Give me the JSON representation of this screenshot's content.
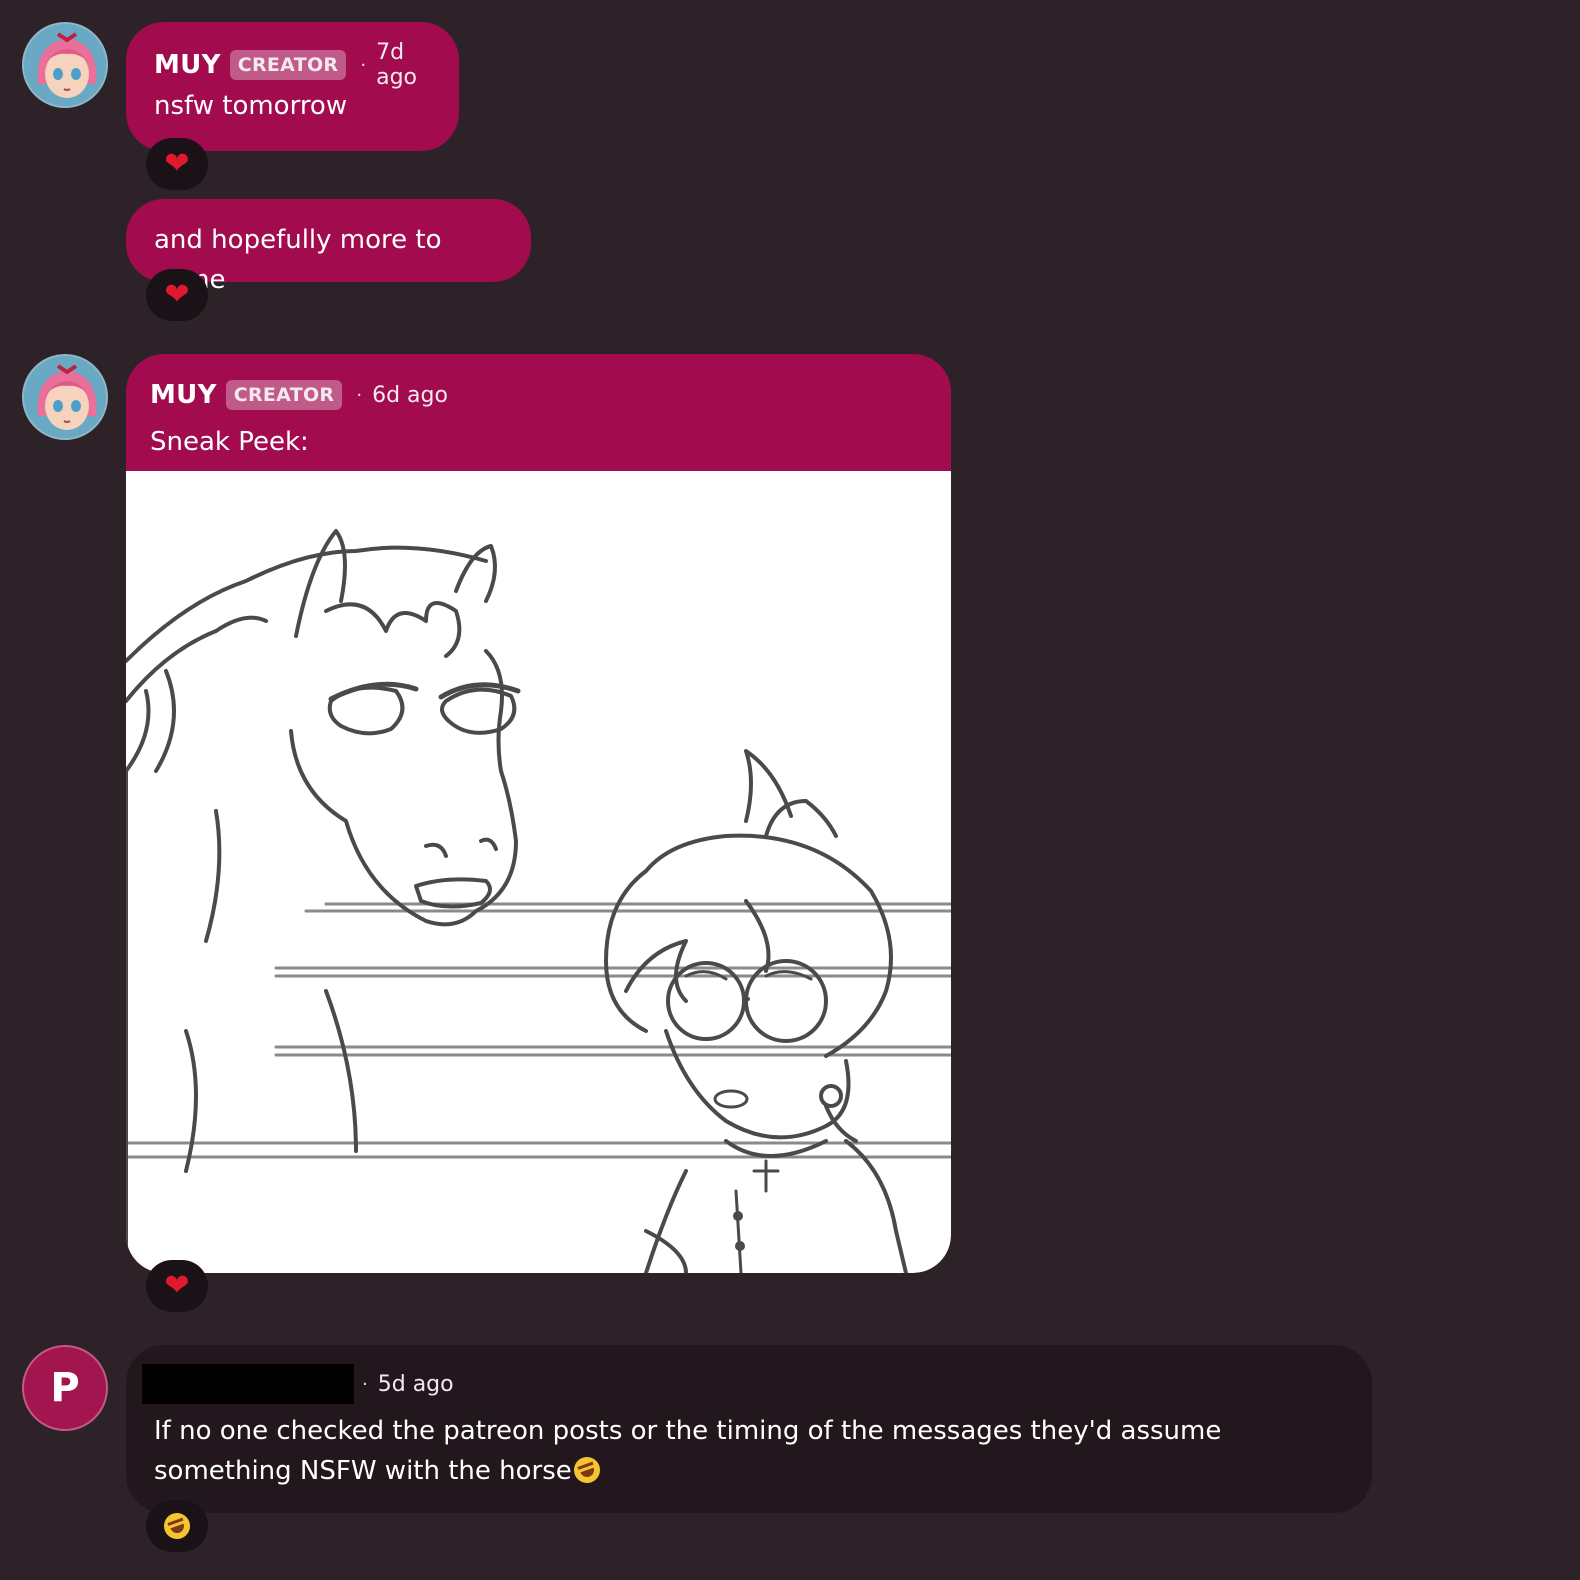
{
  "messages": [
    {
      "author": "MUY",
      "badge": "CREATOR",
      "dot": "·",
      "time": "7d ago",
      "text": "nsfw tomorrow",
      "reaction": "heart"
    },
    {
      "text": "and hopefully more to come",
      "reaction": "heart"
    },
    {
      "author": "MUY",
      "badge": "CREATOR",
      "dot": "·",
      "time": "6d ago",
      "text": "Sneak Peek:",
      "image": "sketch-horse-and-girl",
      "reaction": "heart"
    },
    {
      "avatar_letter": "P",
      "dot": "·",
      "time": "5d ago",
      "text": "If no one checked the patreon posts or the timing of the messages they'd assume something NSFW with the horse",
      "reaction": "rolling-on-floor-laughing"
    }
  ],
  "reaction_glyphs": {
    "heart": "❤"
  },
  "colors": {
    "background": "#2d2227",
    "creator_bubble": "#a20c4f",
    "user_bubble": "#22171d",
    "badge": "#c05a88"
  }
}
